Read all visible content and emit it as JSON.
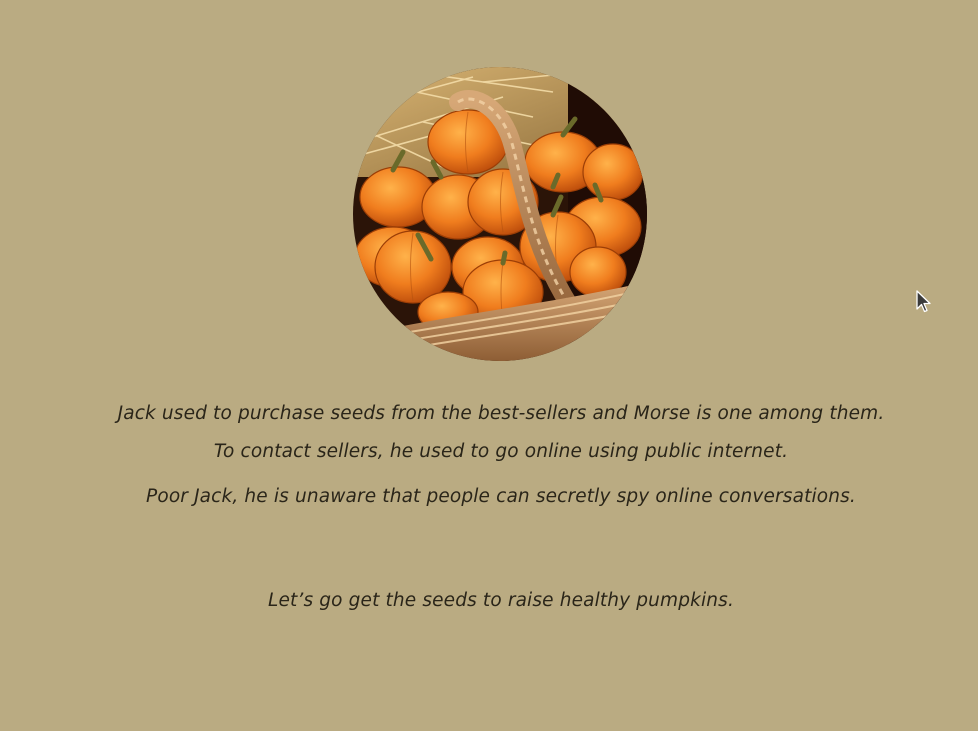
{
  "hero": {
    "icon": "pumpkin-basket-image"
  },
  "story": {
    "line1": "Jack used to purchase seeds from the best-sellers and Morse is one among them.",
    "line2": "To contact sellers, he used to go online using public internet.",
    "line3": "Poor Jack, he is unaware that people can secretly spy online conversations."
  },
  "cta": {
    "text": "Let’s go get the seeds to raise healthy pumpkins."
  },
  "colors": {
    "background": "#baab82",
    "text": "#2a2519",
    "pumpkin": "#ec7a1c"
  }
}
